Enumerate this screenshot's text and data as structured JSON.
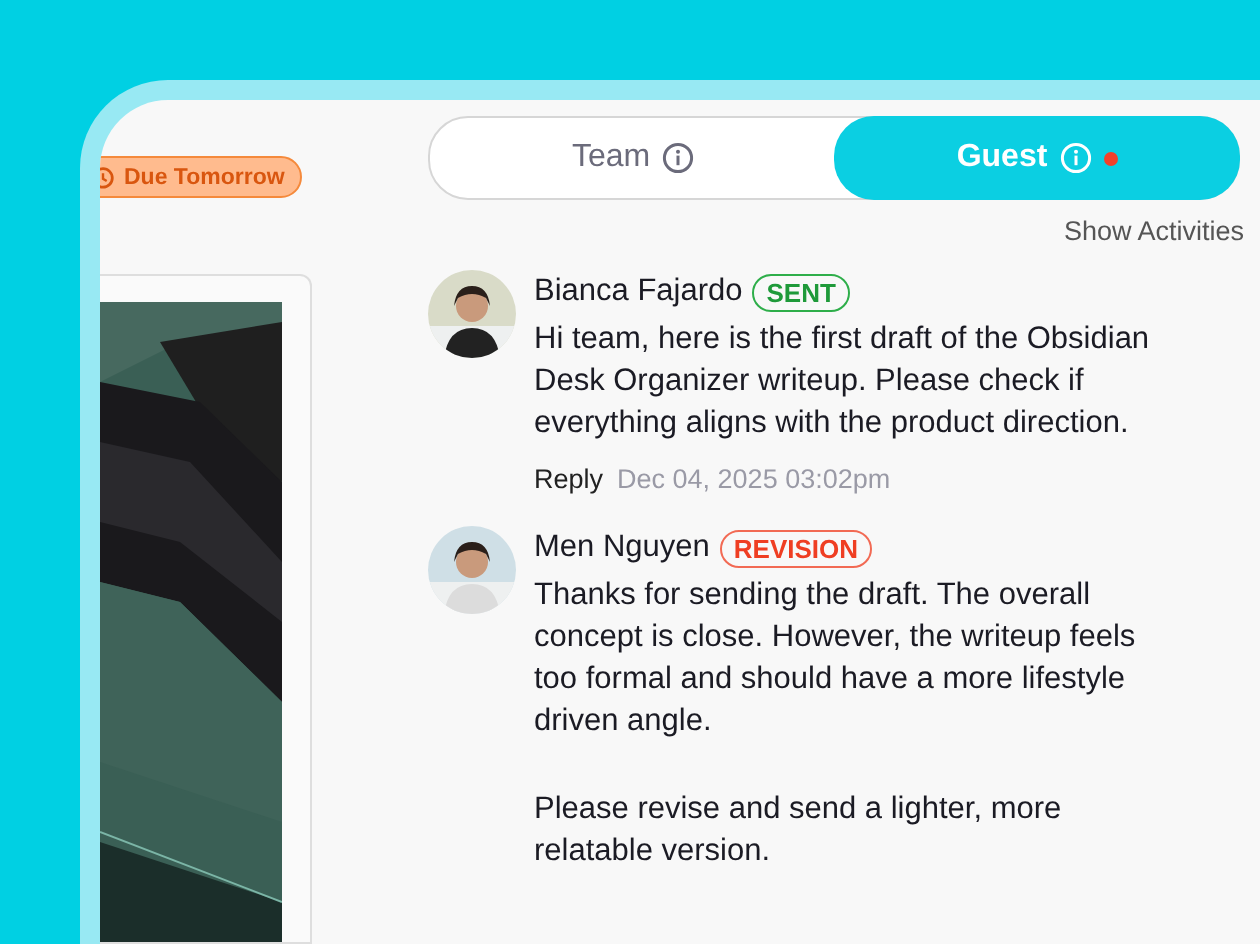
{
  "due_badge": {
    "label": "Due Tomorrow"
  },
  "tabs": [
    {
      "label": "Team",
      "selected": false,
      "dot": false
    },
    {
      "label": "Guest",
      "selected": true,
      "dot": true
    }
  ],
  "show_activities": "Show Activities",
  "messages": [
    {
      "author": "Bianca Fajardo",
      "tag": {
        "kind": "sent",
        "label": "SENT"
      },
      "paragraphs": [
        "Hi team, here is the first draft of the Obsidian Desk Organizer writeup. Please check if everything aligns with the product direction."
      ],
      "reply": "Reply",
      "time": "Dec 04, 2025 03:02pm"
    },
    {
      "author": "Men Nguyen",
      "tag": {
        "kind": "revision",
        "label": "REVISION"
      },
      "paragraphs": [
        "Thanks for sending the draft. The overall concept is close. However, the writeup feels too formal and should have a more lifestyle driven angle.",
        "Please revise and send a lighter, more relatable version."
      ]
    }
  ]
}
